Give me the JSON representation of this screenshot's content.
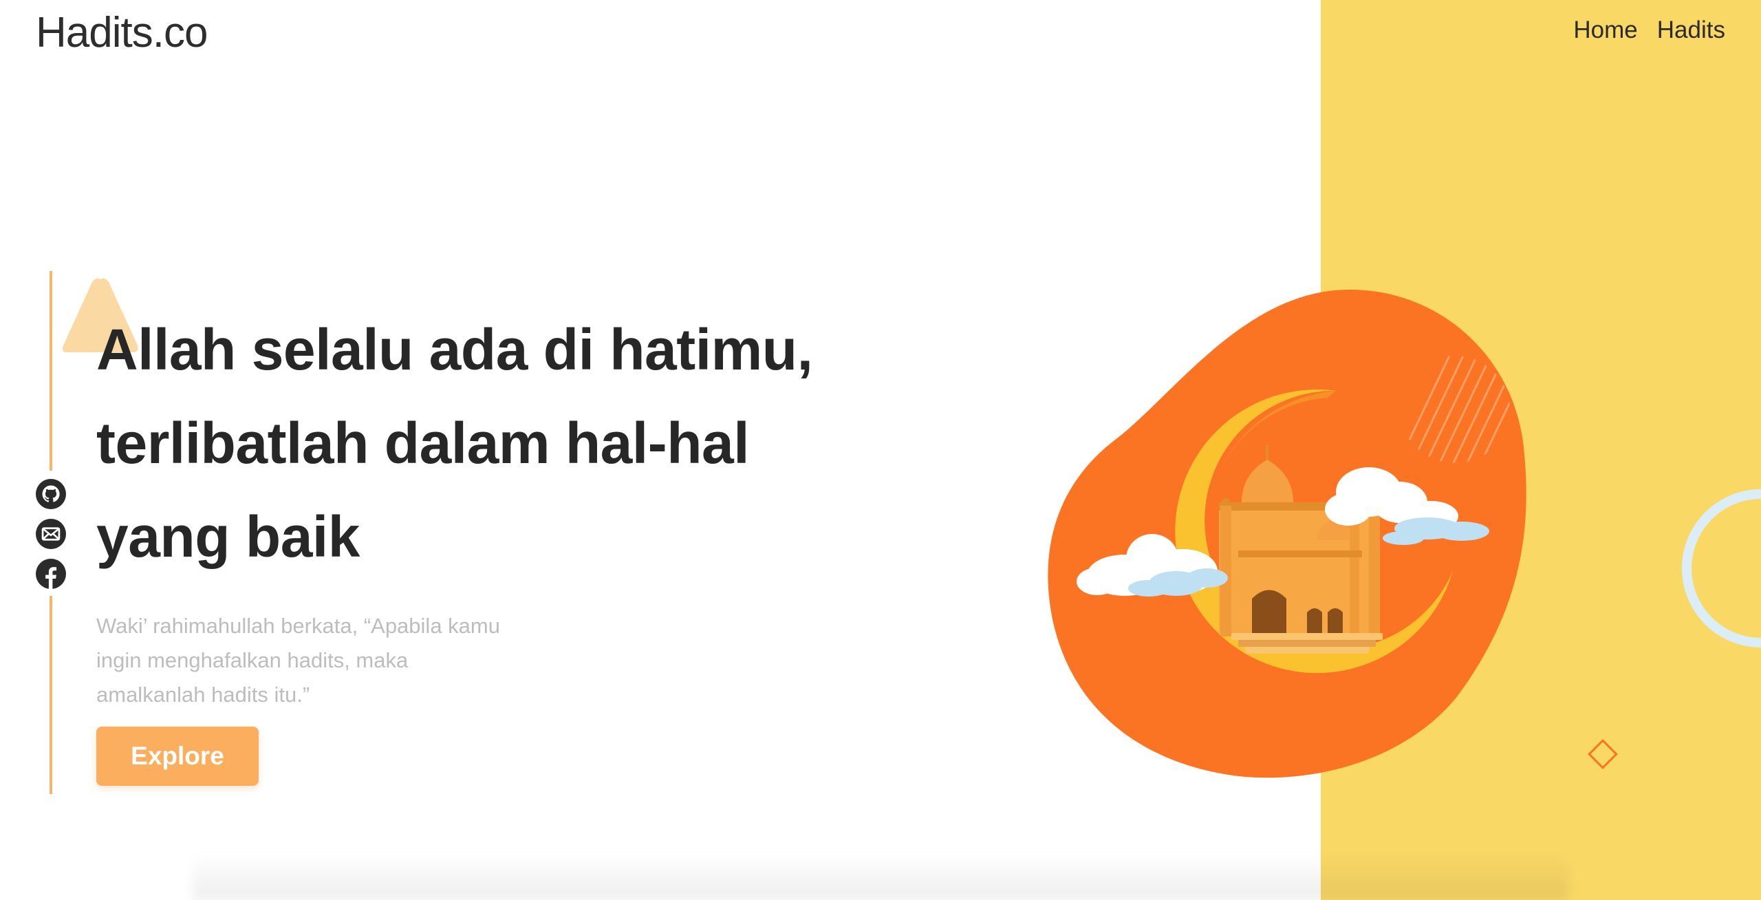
{
  "header": {
    "logo": "Hadits.co",
    "nav": [
      {
        "label": "Home"
      },
      {
        "label": "Hadits"
      }
    ]
  },
  "hero": {
    "headline_lines": [
      "Allah selalu ada di hatimu,",
      "terlibatlah dalam hal-hal",
      "yang baik"
    ],
    "subtext_lines": [
      "Waki’ rahimahullah berkata, “Apabila kamu",
      "ingin menghafalkan hadits, maka",
      "amalkanlah hadits itu.”"
    ],
    "cta_label": "Explore"
  },
  "socials": [
    {
      "icon": "github-icon"
    },
    {
      "icon": "mail-icon"
    },
    {
      "icon": "facebook-icon"
    }
  ],
  "colors": {
    "accent": "#fbae5d",
    "panel": "#f9d866",
    "blob": "#fb7424",
    "moon": "#f9c22e"
  }
}
